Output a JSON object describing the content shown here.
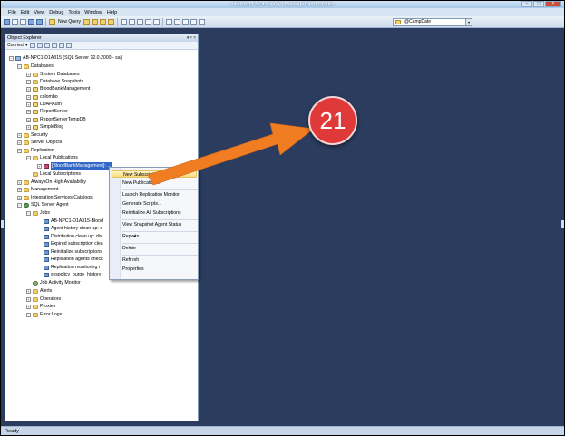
{
  "window": {
    "title": "Microsoft SQL Server Management Studio"
  },
  "menubar": [
    "File",
    "Edit",
    "View",
    "Debug",
    "Tools",
    "Window",
    "Help"
  ],
  "toolbar": {
    "new_query_label": "New Query",
    "database_value": "@CampDate"
  },
  "object_explorer": {
    "title": "Object Explorer",
    "title_controls": "▾ ᵖ ×",
    "connect_label": "Connect ▾",
    "tree": [
      {
        "label": "AB-NPC1-D1A315 (SQL Server 12.0.2000 - sa)",
        "icon": "server",
        "exp": "−"
      },
      {
        "label": "Databases",
        "icon": "folder",
        "exp": "−"
      },
      {
        "label": "System Databases",
        "icon": "folder",
        "exp": "+"
      },
      {
        "label": "Database Snapshots",
        "icon": "folder",
        "exp": "+"
      },
      {
        "label": "BloodBankManagement",
        "icon": "db",
        "exp": "+"
      },
      {
        "label": "colombo",
        "icon": "db",
        "exp": "+"
      },
      {
        "label": "LDAPAuth",
        "icon": "db",
        "exp": "+"
      },
      {
        "label": "ReportServer",
        "icon": "db",
        "exp": "+"
      },
      {
        "label": "ReportServerTempDB",
        "icon": "db",
        "exp": "+"
      },
      {
        "label": "SimpleBlog",
        "icon": "db",
        "exp": "+"
      },
      {
        "label": "Security",
        "icon": "folder",
        "exp": "+"
      },
      {
        "label": "Server Objects",
        "icon": "folder",
        "exp": "+"
      },
      {
        "label": "Replication",
        "icon": "folder",
        "exp": "−"
      },
      {
        "label": "Local Publications",
        "icon": "folder",
        "exp": "−"
      },
      {
        "label": "[BloodBankManagement]: ...",
        "icon": "pub",
        "exp": "+"
      },
      {
        "label": "Local Subscriptions",
        "icon": "folder",
        "exp": "none"
      },
      {
        "label": "AlwaysOn High Availability",
        "icon": "folder",
        "exp": "+"
      },
      {
        "label": "Management",
        "icon": "folder",
        "exp": "+"
      },
      {
        "label": "Integration Services Catalogs",
        "icon": "folder",
        "exp": "+"
      },
      {
        "label": "SQL Server Agent",
        "icon": "agent",
        "exp": "−"
      },
      {
        "label": "Jobs",
        "icon": "folder",
        "exp": "−"
      },
      {
        "label": "AB-NPC1-D1A315-Blood",
        "icon": "job",
        "exp": "none"
      },
      {
        "label": "Agent history clean up: c",
        "icon": "job",
        "exp": "none"
      },
      {
        "label": "Distribution clean up: dis",
        "icon": "job",
        "exp": "none"
      },
      {
        "label": "Expired subscription clea",
        "icon": "job",
        "exp": "none"
      },
      {
        "label": "Reinitialize subscriptions",
        "icon": "job",
        "exp": "none"
      },
      {
        "label": "Replication agents check",
        "icon": "job",
        "exp": "none"
      },
      {
        "label": "Replication monitoring r",
        "icon": "job",
        "exp": "none"
      },
      {
        "label": "syspolicy_purge_history",
        "icon": "job",
        "exp": "none"
      },
      {
        "label": "Job Activity Monitor",
        "icon": "monitor",
        "exp": "none"
      },
      {
        "label": "Alerts",
        "icon": "folder",
        "exp": "+"
      },
      {
        "label": "Operators",
        "icon": "folder",
        "exp": "+"
      },
      {
        "label": "Proxies",
        "icon": "folder",
        "exp": "+"
      },
      {
        "label": "Error Logs",
        "icon": "folder",
        "exp": "+"
      }
    ]
  },
  "context_menu": {
    "items": [
      {
        "label": "New Subscriptions...",
        "highlighted": true
      },
      {
        "label": "New Publication..."
      },
      {
        "separator": true
      },
      {
        "label": "Launch Replication Monitor"
      },
      {
        "label": "Generate Scripts..."
      },
      {
        "label": "Reinitialize All Subscriptions"
      },
      {
        "separator": true
      },
      {
        "label": "View Snapshot Agent Status"
      },
      {
        "separator": true
      },
      {
        "label": "Reports",
        "submenu": true
      },
      {
        "separator": true
      },
      {
        "label": "Delete"
      },
      {
        "separator": true
      },
      {
        "label": "Refresh"
      },
      {
        "label": "Properties"
      }
    ]
  },
  "callout": {
    "number": "21",
    "color": "#e0393a",
    "arrow_color": "#f07d22"
  },
  "status": {
    "text": "Ready"
  },
  "colors": {
    "workspace": "#2b3c5e",
    "selection": "#3168c7",
    "menu_highlight": "#fbdb7b"
  }
}
